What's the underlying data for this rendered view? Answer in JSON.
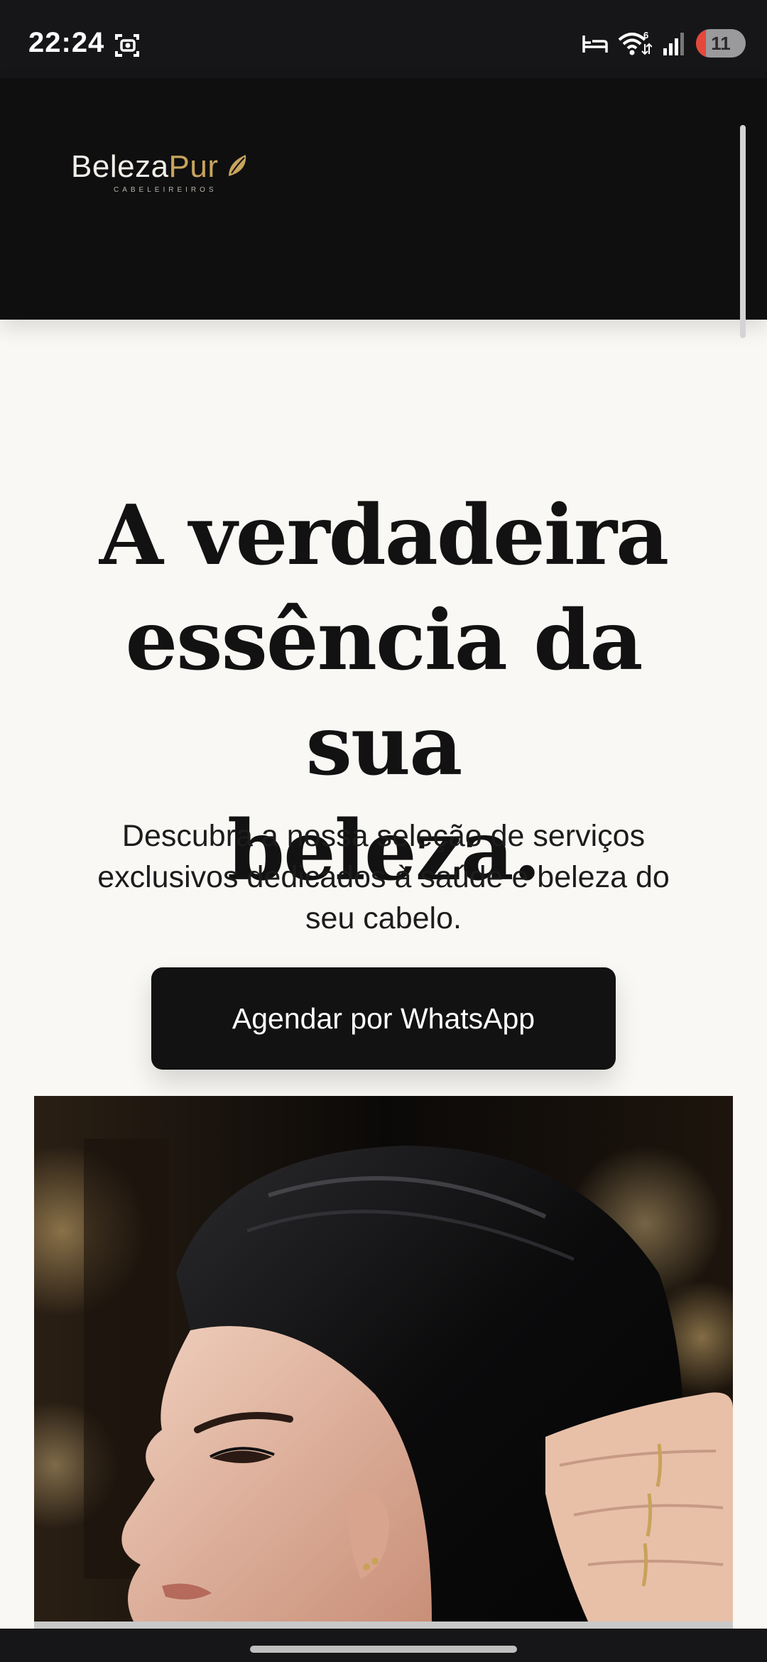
{
  "status_bar": {
    "time": "22:24",
    "battery_level": "11",
    "icons": [
      "screenshot-icon",
      "sleep-mode-icon",
      "wifi-icon",
      "signal-icon",
      "battery-icon"
    ],
    "wifi_badge": "6"
  },
  "header": {
    "logo": {
      "name_part1": "Beleza",
      "name_part2": "Pur",
      "tagline": "CABELEIREIROS",
      "accent_color": "#c8a45d"
    }
  },
  "hero": {
    "title_lines": [
      "A verdadeira",
      "essência da sua",
      "beleza."
    ],
    "subtitle_lines": [
      "Descubra a nossa seleção de serviços",
      "exclusivos dedicados à saúde e beleza do",
      "seu cabelo."
    ],
    "cta_label": "Agendar por WhatsApp",
    "image_icon": "woman-black-hair-profile-photo"
  },
  "colors": {
    "page_background": "#faf8f5",
    "header_background": "#0f0f10",
    "button_background": "#121212",
    "text_dark": "#121212"
  }
}
